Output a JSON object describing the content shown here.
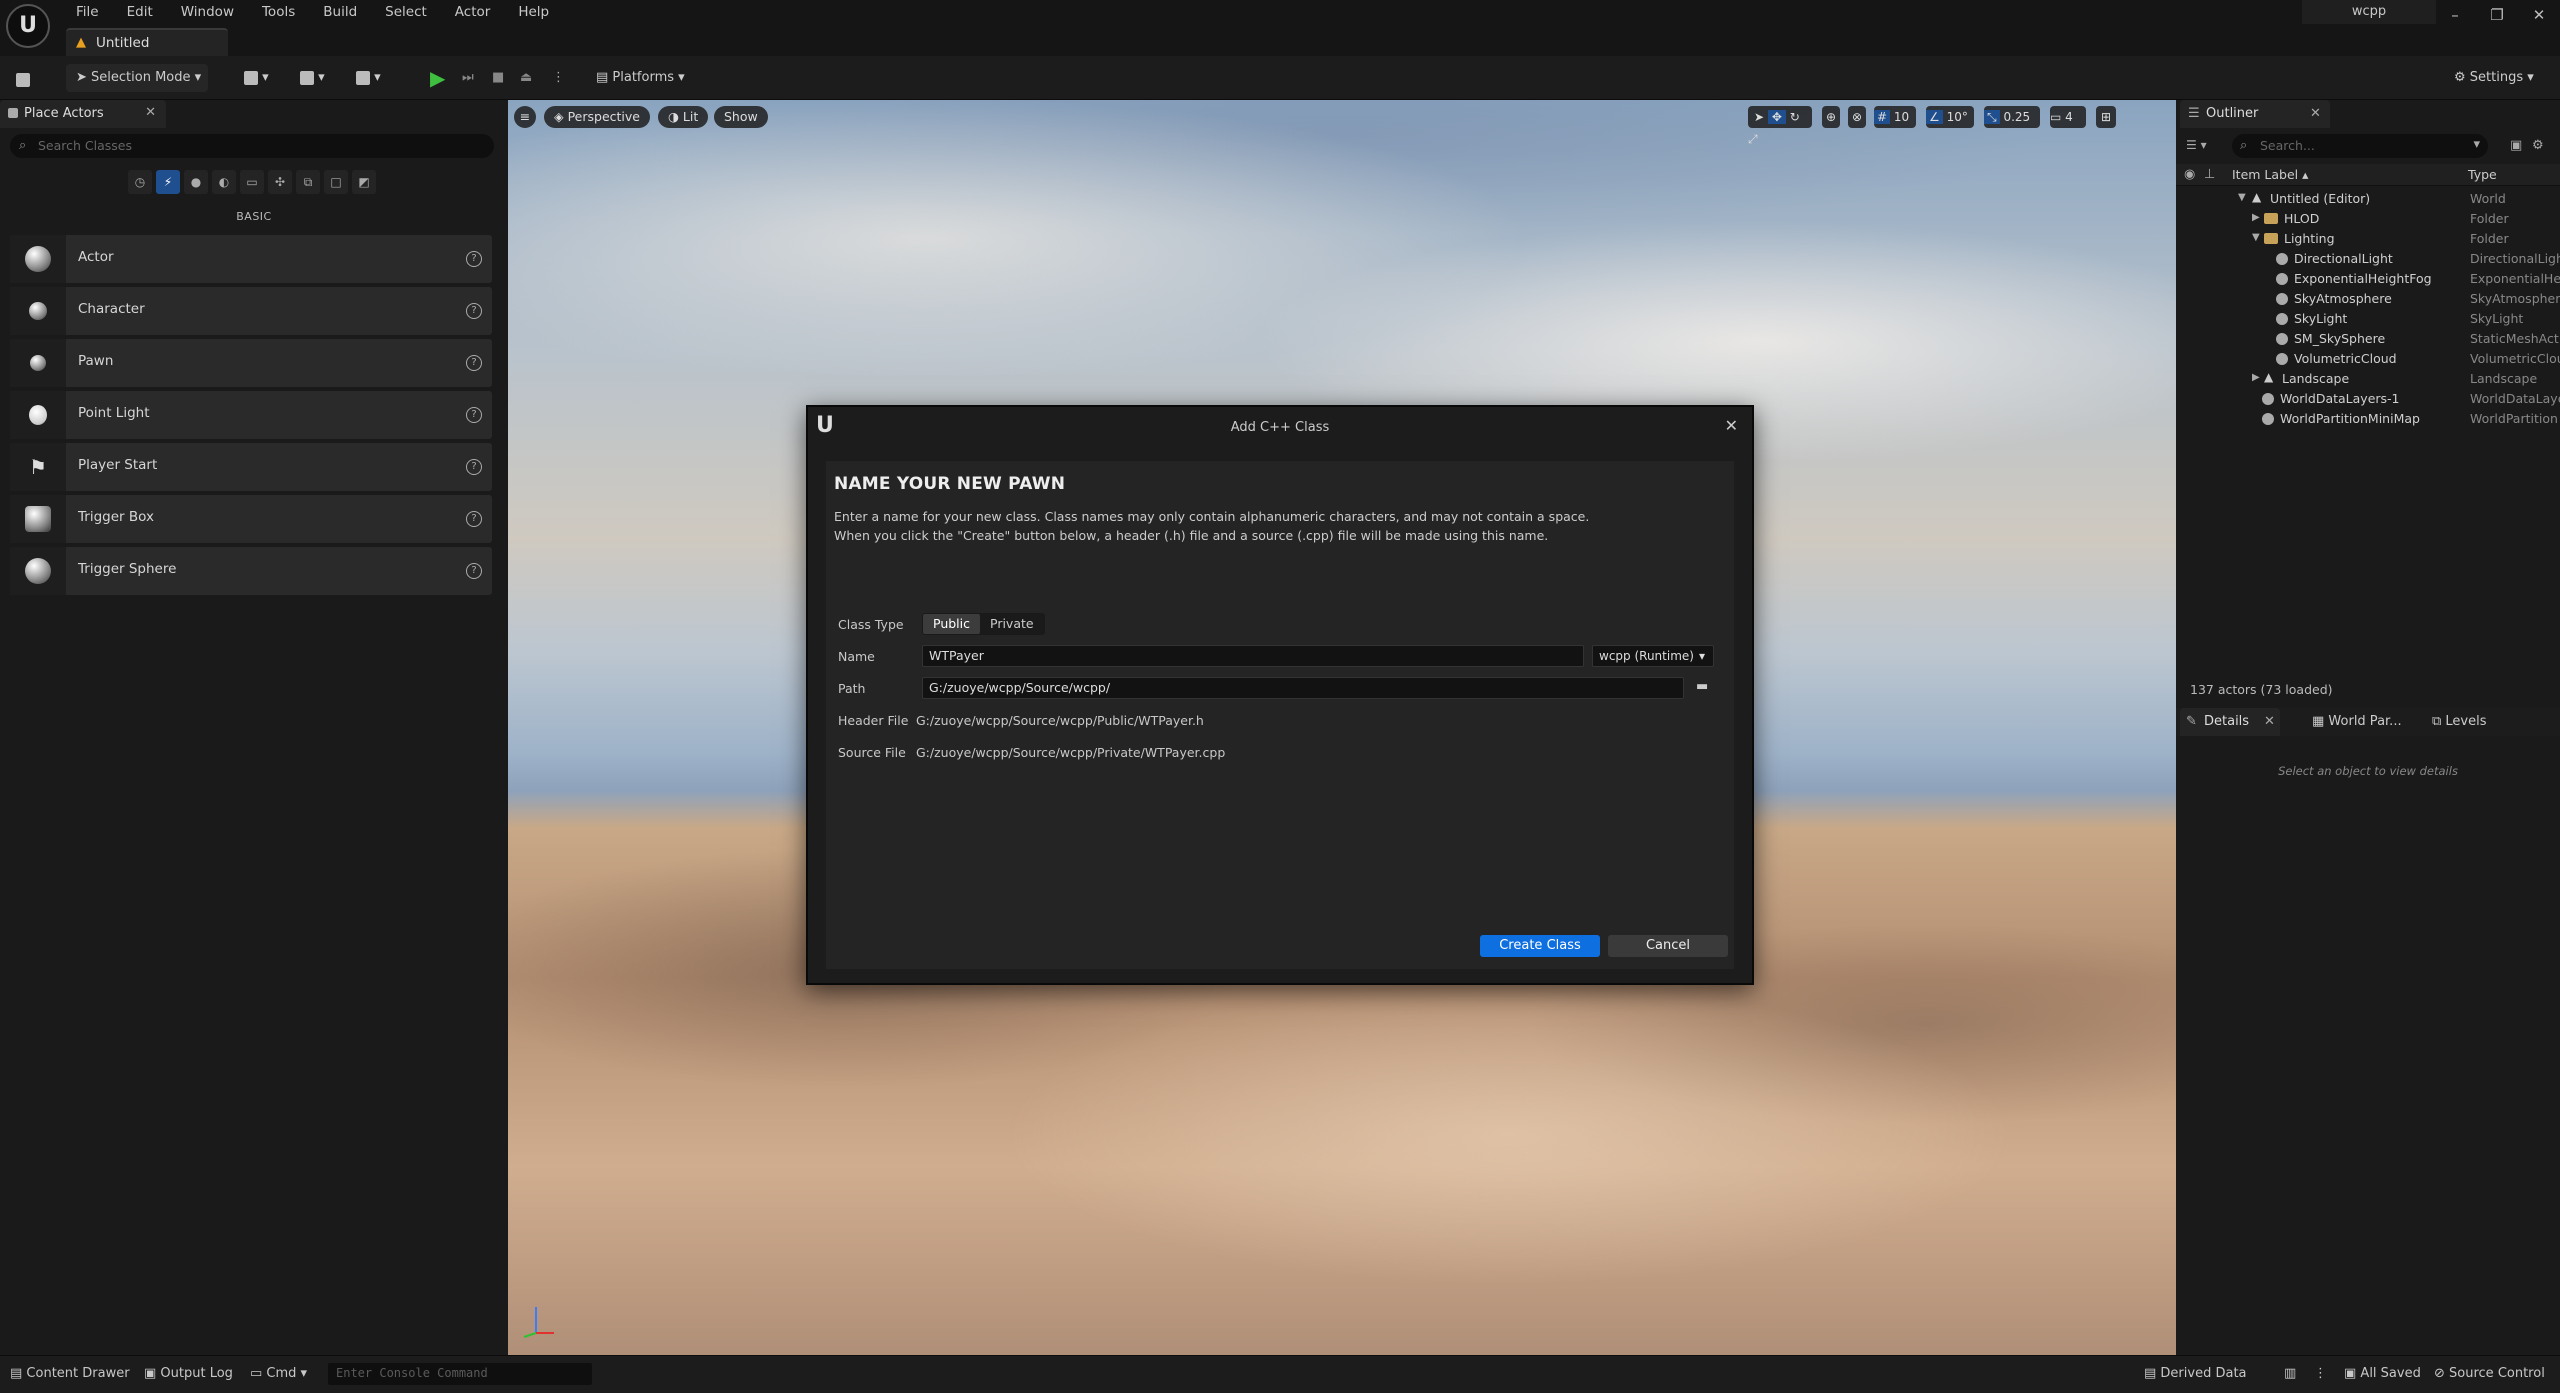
{
  "menu": [
    "File",
    "Edit",
    "Window",
    "Tools",
    "Build",
    "Select",
    "Actor",
    "Help"
  ],
  "document_tab": "Untitled",
  "project_name": "wcpp",
  "toolbar": {
    "selection_mode": "Selection Mode",
    "platforms": "Platforms",
    "settings": "Settings"
  },
  "place_actors": {
    "tab_label": "Place Actors",
    "search_placeholder": "Search Classes",
    "section": "BASIC",
    "items": [
      "Actor",
      "Character",
      "Pawn",
      "Point Light",
      "Player Start",
      "Trigger Box",
      "Trigger Sphere"
    ]
  },
  "viewport": {
    "perspective": "Perspective",
    "lit": "Lit",
    "show": "Show",
    "grid_snap": "10",
    "rotation_snap": "10°",
    "scale_snap": "0.25",
    "camera_speed": "4"
  },
  "outliner": {
    "tab_label": "Outliner",
    "search_placeholder": "Search...",
    "col_label": "Item Label",
    "col_type": "Type",
    "rows": [
      {
        "name": "Untitled (Editor)",
        "type": "World"
      },
      {
        "name": "HLOD",
        "type": "Folder"
      },
      {
        "name": "Lighting",
        "type": "Folder"
      },
      {
        "name": "DirectionalLight",
        "type": "DirectionalLight"
      },
      {
        "name": "ExponentialHeightFog",
        "type": "ExponentialHei"
      },
      {
        "name": "SkyAtmosphere",
        "type": "SkyAtmospher"
      },
      {
        "name": "SkyLight",
        "type": "SkyLight"
      },
      {
        "name": "SM_SkySphere",
        "type": "StaticMeshAct"
      },
      {
        "name": "VolumetricCloud",
        "type": "VolumetricClou"
      },
      {
        "name": "Landscape",
        "type": "Landscape"
      },
      {
        "name": "WorldDataLayers-1",
        "type": "WorldDataLaye"
      },
      {
        "name": "WorldPartitionMiniMap",
        "type": "WorldPartition"
      }
    ],
    "actor_count": "137 actors (73 loaded)"
  },
  "details": {
    "tabs": [
      "Details",
      "World Par...",
      "Levels"
    ],
    "empty_text": "Select an object to view details"
  },
  "status_bar": {
    "content_drawer": "Content Drawer",
    "output_log": "Output Log",
    "cmd": "Cmd",
    "console_placeholder": "Enter Console Command",
    "derived_data": "Derived Data",
    "all_saved": "All Saved",
    "source_control": "Source Control"
  },
  "dialog": {
    "title": "Add C++ Class",
    "heading": "NAME YOUR NEW PAWN",
    "desc1": "Enter a name for your new class. Class names may only contain alphanumeric characters, and may not contain a space.",
    "desc2": "When you click the \"Create\" button below, a header (.h) file and a source (.cpp) file will be made using this name.",
    "class_type_label": "Class Type",
    "class_type_options": [
      "Public",
      "Private"
    ],
    "class_type_selected": "Public",
    "name_label": "Name",
    "name_value": "WTPayer",
    "module": "wcpp (Runtime)",
    "path_label": "Path",
    "path_value": "G:/zuoye/wcpp/Source/wcpp/",
    "header_label": "Header File",
    "header_value": "G:/zuoye/wcpp/Source/wcpp/Public/WTPayer.h",
    "source_label": "Source File",
    "source_value": "G:/zuoye/wcpp/Source/wcpp/Private/WTPayer.cpp",
    "create_button": "Create Class",
    "cancel_button": "Cancel"
  }
}
